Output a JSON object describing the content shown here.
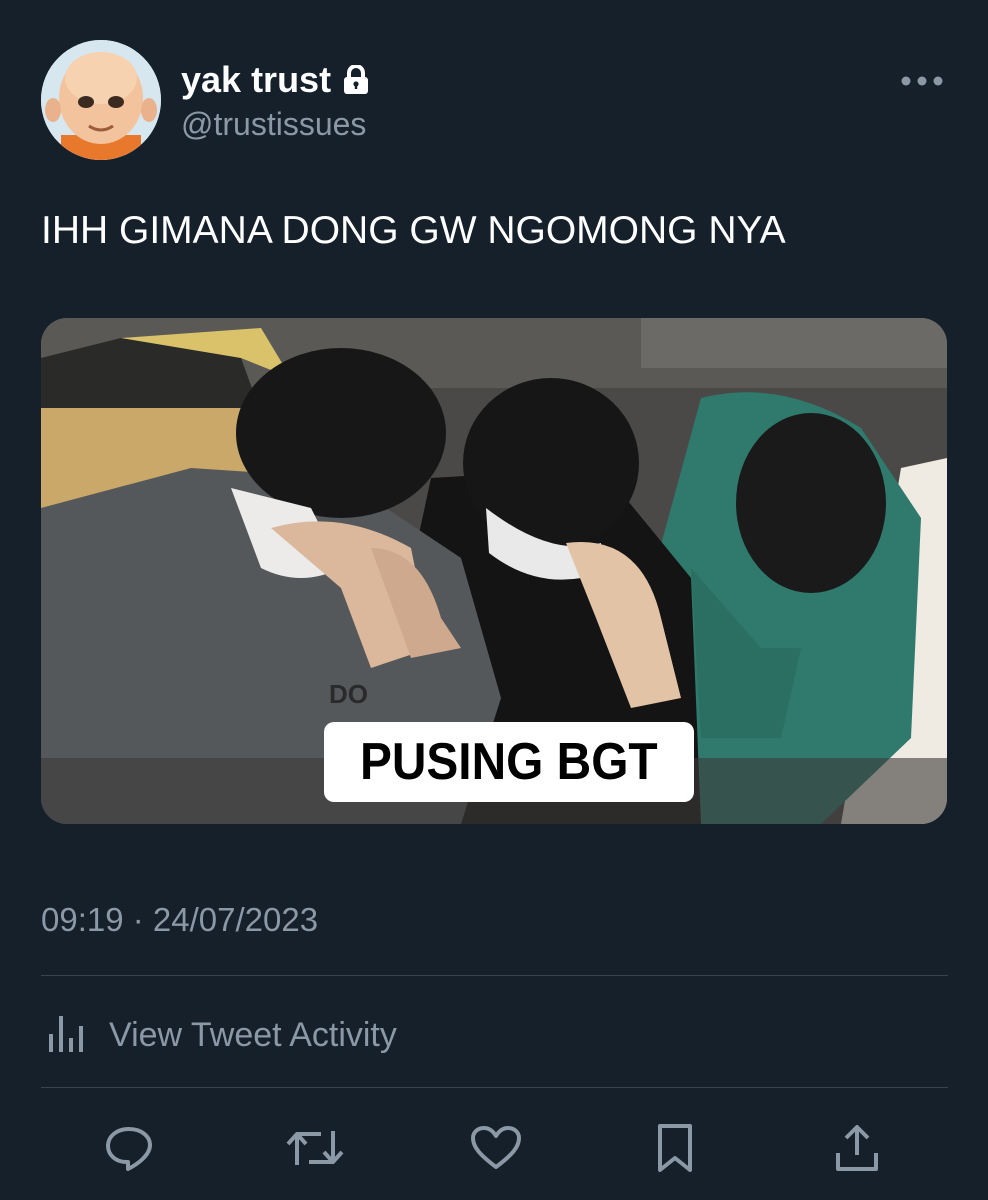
{
  "tweet": {
    "display_name": "yak trust",
    "handle": "@trustissues",
    "protected_icon": "lock-icon",
    "text": "IHH GIMANA DONG GW NGOMONG NYA",
    "media": {
      "caption": "PUSING BGT",
      "shirt_print": "DO"
    },
    "timestamp": "09:19 · 24/07/2023"
  },
  "activity": {
    "label": "View Tweet Activity",
    "icon": "analytics-icon"
  },
  "actions": [
    {
      "name": "reply",
      "icon": "reply-icon"
    },
    {
      "name": "retweet",
      "icon": "retweet-icon"
    },
    {
      "name": "like",
      "icon": "heart-icon"
    },
    {
      "name": "bookmark",
      "icon": "bookmark-icon"
    },
    {
      "name": "share",
      "icon": "share-icon"
    }
  ],
  "colors": {
    "background": "#15202b",
    "text_primary": "#ffffff",
    "text_secondary": "#8b98a5",
    "divider": "#38444d"
  }
}
